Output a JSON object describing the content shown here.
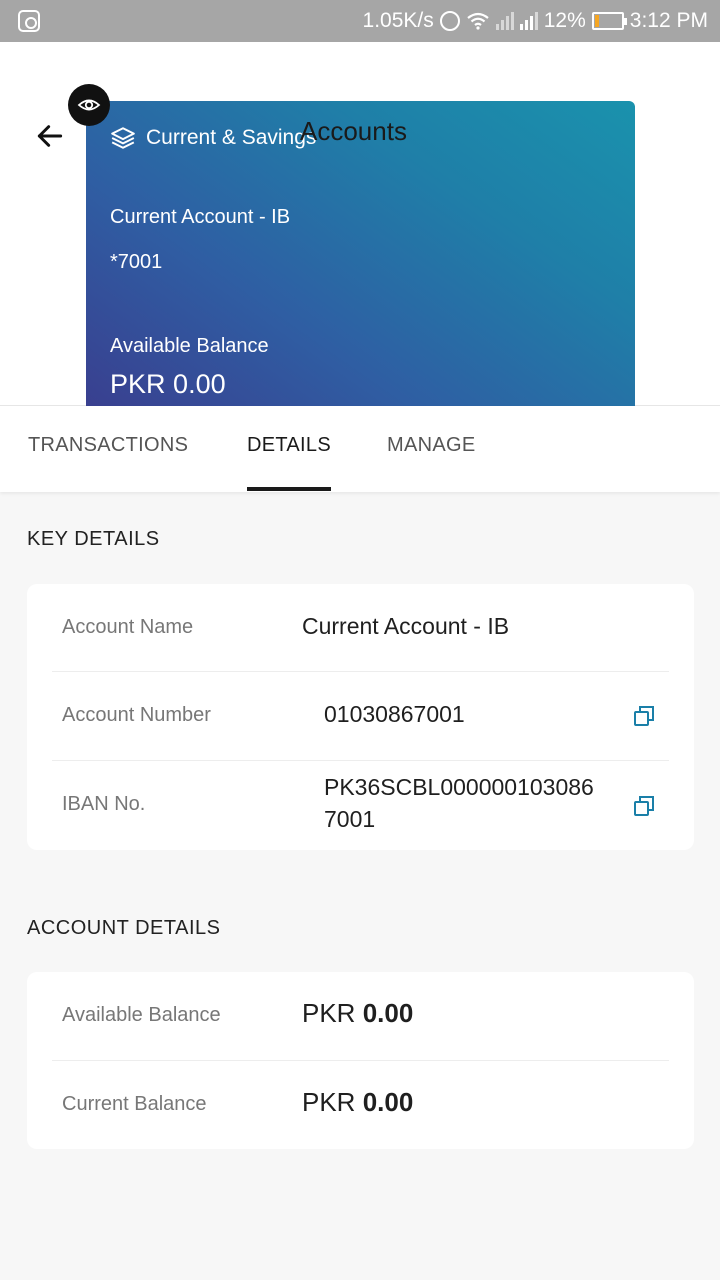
{
  "status_bar": {
    "net_speed": "1.05K/s",
    "battery": "12%",
    "time": "3:12 PM",
    "icons": [
      "notification-icon",
      "alarm-icon",
      "wifi-icon",
      "signal-icon",
      "signal-icon",
      "battery-icon"
    ]
  },
  "header": {
    "title": "Accounts",
    "back_icon": "arrow-left-icon",
    "eye_icon": "eye-icon"
  },
  "card": {
    "type_label": "Current & Savings",
    "type_icon": "layers-icon",
    "account_name": "Current Account - IB",
    "account_mask": "*7001",
    "balance_label": "Available Balance",
    "balance_currency": "PKR",
    "balance_amount": "0.00",
    "gradient_colors": [
      "#3a3d8e",
      "#1a92ad"
    ]
  },
  "tabs": {
    "items": [
      {
        "label": "TRANSACTIONS",
        "active": false
      },
      {
        "label": "DETAILS",
        "active": true
      },
      {
        "label": "MANAGE",
        "active": false
      }
    ]
  },
  "key_details": {
    "title": "KEY DETAILS",
    "rows": [
      {
        "label": "Account Name",
        "value": "Current Account - IB"
      },
      {
        "label": "Account Number",
        "value": "01030867001",
        "action_icon": "copy-icon"
      },
      {
        "label": "IBAN No.",
        "value_line1": "PK36SCBL000000103086",
        "value_line2": "7001",
        "action_icon": "copy-icon"
      }
    ]
  },
  "account_details": {
    "title": "ACCOUNT DETAILS",
    "rows": [
      {
        "label": "Available Balance",
        "currency": "PKR",
        "amount": "0.00"
      },
      {
        "label": "Current Balance",
        "currency": "PKR",
        "amount": "0.00"
      }
    ]
  },
  "colors": {
    "accent": "#1a7fa8",
    "tab_indicator": "#1a1a1a",
    "background": "#f7f7f7"
  }
}
